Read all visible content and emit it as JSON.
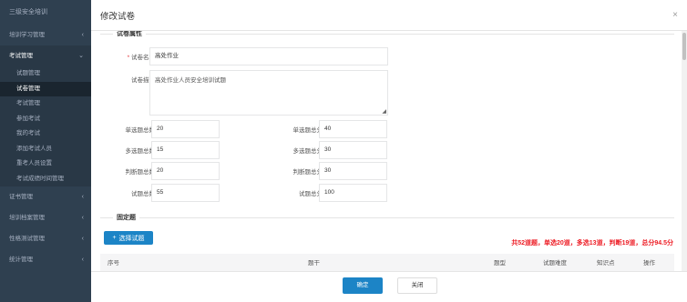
{
  "sidebar": {
    "brand": "三级安全培训",
    "menus": [
      {
        "label": "培训学习管理",
        "chevron": "‹"
      },
      {
        "label": "考试管理",
        "chevron": "⌄"
      }
    ],
    "exam_sub": [
      {
        "label": "试题管理"
      },
      {
        "label": "试卷管理"
      },
      {
        "label": "考试管理"
      },
      {
        "label": "参加考试"
      },
      {
        "label": "我的考试"
      },
      {
        "label": "添加考试人员"
      },
      {
        "label": "重考人员设置"
      },
      {
        "label": "考试成绩时间管理"
      }
    ],
    "menus_after": [
      {
        "label": "证书管理",
        "chevron": "‹"
      },
      {
        "label": "培训档案管理",
        "chevron": "‹"
      },
      {
        "label": "性格测试管理",
        "chevron": "‹"
      },
      {
        "label": "统计管理",
        "chevron": "‹"
      }
    ]
  },
  "modal": {
    "title": "修改试卷",
    "close": "×",
    "attrs_section": "试卷属性",
    "name_label": "试卷名称",
    "name_required": "*",
    "name_value": "高处作业",
    "desc_label": "试卷描述",
    "desc_value": "高处作业人员安全培训试题",
    "rows": [
      {
        "l_label": "单选题总数",
        "l_value": "20",
        "r_label": "单选题总分",
        "r_value": "40"
      },
      {
        "l_label": "多选题总数",
        "l_value": "15",
        "r_label": "多选题总分",
        "r_value": "30"
      },
      {
        "l_label": "判断题总数",
        "l_value": "20",
        "r_label": "判断题总分",
        "r_value": "30"
      },
      {
        "l_label": "试题总数",
        "l_value": "55",
        "r_label": "试题总分",
        "r_value": "100"
      }
    ],
    "fixed_section": "固定题",
    "select_btn": "选择试题",
    "select_icon": "+",
    "summary": "共52道题，单选20道，多选13道，判断19道，总分94.5分",
    "table_headers": [
      "序号",
      "题干",
      "题型",
      "试题难度",
      "知识点",
      "操作"
    ],
    "ok_btn": "确定",
    "close_btn": "关闭"
  }
}
